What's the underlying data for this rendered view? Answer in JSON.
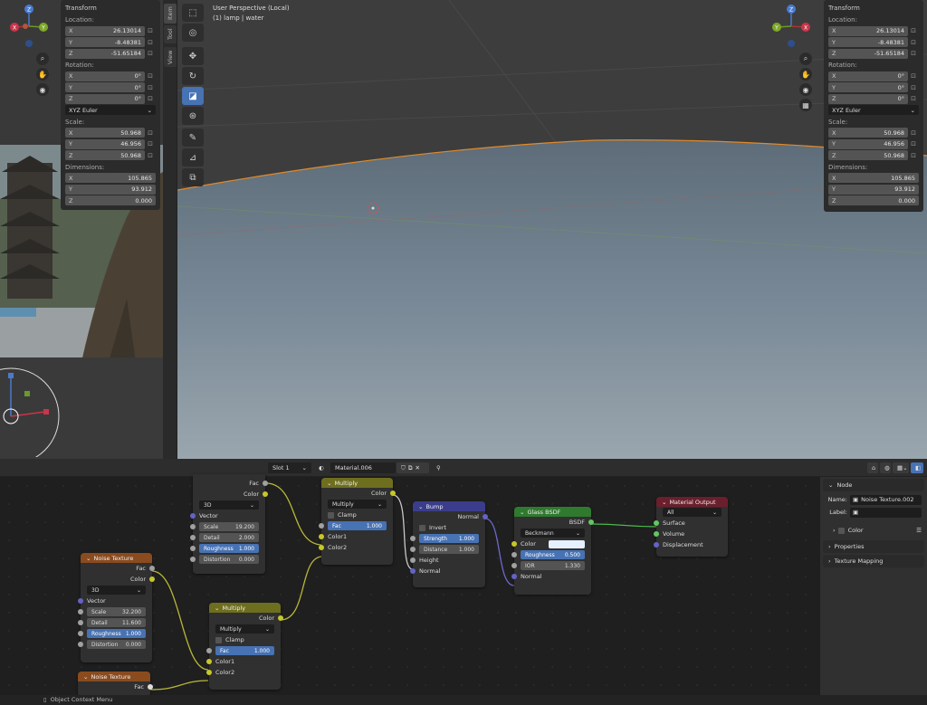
{
  "viewport": {
    "title": "User Perspective (Local)",
    "subtitle": "(1) lamp | water"
  },
  "sidebar_tabs": [
    "Item",
    "Tool",
    "View"
  ],
  "transform": {
    "header": "Transform",
    "location_label": "Location:",
    "location": {
      "x": "26.13014",
      "y": "-8.48381",
      "z": "-51.65184"
    },
    "rotation_label": "Rotation:",
    "rotation": {
      "x": "0°",
      "y": "0°",
      "z": "0°"
    },
    "rotation_mode": "XYZ Euler",
    "scale_label": "Scale:",
    "scale": {
      "x": "50.968",
      "y": "46.956",
      "z": "50.968"
    },
    "dimensions_label": "Dimensions:",
    "dimensions": {
      "x": "105.865",
      "y": "93.912",
      "z": "0.000"
    },
    "axis": {
      "x": "X",
      "y": "Y",
      "z": "Z"
    }
  },
  "gizmo": {
    "x": "X",
    "y": "Y",
    "z": "Z"
  },
  "node_header": {
    "slot": "Slot 1",
    "material": "Material.006"
  },
  "nodes": {
    "noise_top": {
      "outputs": [
        "Fac",
        "Color"
      ],
      "dim": "3D",
      "vector": "Vector",
      "scale_k": "Scale",
      "scale_v": "19.200",
      "detail_k": "Detail",
      "detail_v": "2.000",
      "rough_k": "Roughness",
      "rough_v": "1.000",
      "dist_k": "Distortion",
      "dist_v": "0.000"
    },
    "noise1": {
      "title": "Noise Texture",
      "outputs": [
        "Fac",
        "Color"
      ],
      "dim": "3D",
      "vector": "Vector",
      "scale_k": "Scale",
      "scale_v": "32.200",
      "detail_k": "Detail",
      "detail_v": "11.600",
      "rough_k": "Roughness",
      "rough_v": "1.000",
      "dist_k": "Distortion",
      "dist_v": "0.000"
    },
    "noise2": {
      "title": "Noise Texture",
      "fac": "Fac"
    },
    "multiply1": {
      "title": "Multiply",
      "out": "Color",
      "op": "Multiply",
      "clamp": "Clamp",
      "fac_k": "Fac",
      "fac_v": "1.000",
      "c1": "Color1",
      "c2": "Color2"
    },
    "multiply2": {
      "title": "Multiply",
      "out": "Color",
      "op": "Multiply",
      "clamp": "Clamp",
      "fac_k": "Fac",
      "fac_v": "1.000",
      "c1": "Color1",
      "c2": "Color2"
    },
    "bump": {
      "title": "Bump",
      "out": "Normal",
      "invert": "Invert",
      "strength_k": "Strength",
      "strength_v": "1.000",
      "distance_k": "Distance",
      "distance_v": "1.000",
      "height": "Height",
      "normal": "Normal"
    },
    "glass": {
      "title": "Glass BSDF",
      "out": "BSDF",
      "dist": "Beckmann",
      "color": "Color",
      "rough_k": "Roughness",
      "rough_v": "0.500",
      "ior_k": "IOR",
      "ior_v": "1.330",
      "normal": "Normal"
    },
    "output": {
      "title": "Material Output",
      "target": "All",
      "surface": "Surface",
      "volume": "Volume",
      "displacement": "Displacement"
    }
  },
  "node_panel": {
    "header": "Node",
    "name_label": "Name:",
    "name_value": "Noise Texture.002",
    "label_label": "Label:",
    "color": "Color",
    "properties": "Properties",
    "texture_mapping": "Texture Mapping"
  },
  "status": {
    "text": "Object Context Menu"
  },
  "colors": {
    "noise_header": "#8a4b1f",
    "mix_header": "#6e6e1f",
    "bump_header": "#3b3d8c",
    "shader_header": "#2f7a2f",
    "output_header": "#6b1f2c",
    "active": "#4772b3"
  }
}
